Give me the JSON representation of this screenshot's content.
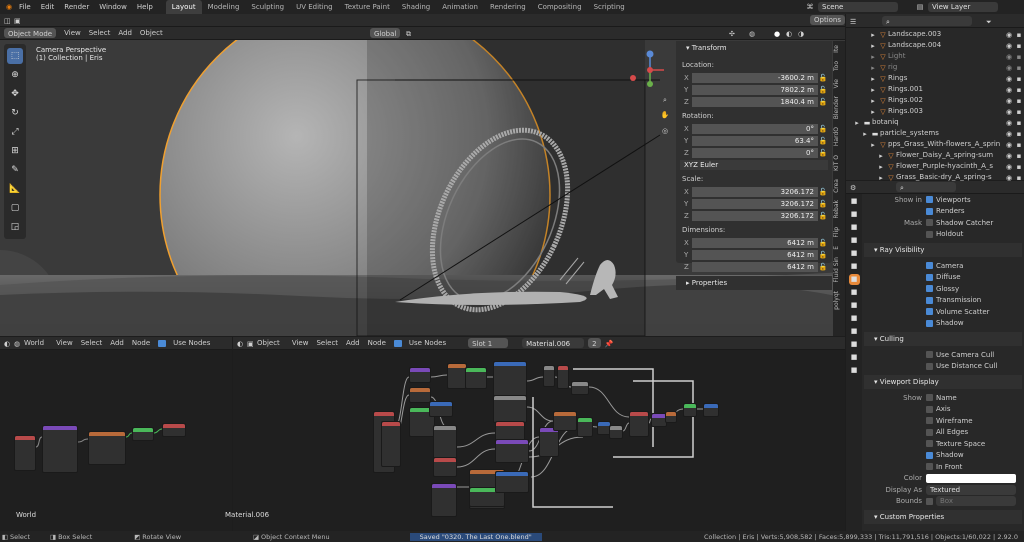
{
  "menu": [
    "File",
    "Edit",
    "Render",
    "Window",
    "Help"
  ],
  "workspaces": [
    {
      "label": "Layout",
      "active": true
    },
    {
      "label": "Modeling"
    },
    {
      "label": "Sculpting"
    },
    {
      "label": "UV Editing"
    },
    {
      "label": "Texture Paint"
    },
    {
      "label": "Shading"
    },
    {
      "label": "Animation"
    },
    {
      "label": "Rendering"
    },
    {
      "label": "Compositing"
    },
    {
      "label": "Scripting"
    }
  ],
  "scene": {
    "label": "Scene",
    "view_layer": "View Layer"
  },
  "viewport": {
    "mode": "Object Mode",
    "menus": [
      "View",
      "Select",
      "Add",
      "Object"
    ],
    "orientation": "Global",
    "options": "Options",
    "info_line1": "Camera Perspective",
    "info_line2": "(1) Collection | Eris"
  },
  "transform": {
    "title": "Transform",
    "location_label": "Location:",
    "location": [
      {
        "axis": "X",
        "value": "-3600.2 m"
      },
      {
        "axis": "Y",
        "value": "7802.2 m"
      },
      {
        "axis": "Z",
        "value": "1840.4 m"
      }
    ],
    "rotation_label": "Rotation:",
    "rotation": [
      {
        "axis": "X",
        "value": "0°"
      },
      {
        "axis": "Y",
        "value": "63.4°"
      },
      {
        "axis": "Z",
        "value": "0°"
      }
    ],
    "rotation_mode": "XYZ Euler",
    "scale_label": "Scale:",
    "scale": [
      {
        "axis": "X",
        "value": "3206.172"
      },
      {
        "axis": "Y",
        "value": "3206.172"
      },
      {
        "axis": "Z",
        "value": "3206.172"
      }
    ],
    "dimensions_label": "Dimensions:",
    "dimensions": [
      {
        "axis": "X",
        "value": "6412 m"
      },
      {
        "axis": "Y",
        "value": "6412 m"
      },
      {
        "axis": "Z",
        "value": "6412 m"
      }
    ],
    "properties": "Properties"
  },
  "npanel_tabs": [
    "Ite",
    "Too",
    "Vie",
    "Blender",
    "HardO",
    "KIT O",
    "Crea",
    "Rebak",
    "Flip",
    "E",
    "Fluid Sin",
    "polyqt"
  ],
  "outliner": [
    {
      "name": "Landscape.003",
      "indent": 2
    },
    {
      "name": "Landscape.004",
      "indent": 2
    },
    {
      "name": "Light",
      "indent": 2,
      "dim": true
    },
    {
      "name": "rig",
      "indent": 2,
      "dim": true
    },
    {
      "name": "Rings",
      "indent": 2
    },
    {
      "name": "Rings.001",
      "indent": 2
    },
    {
      "name": "Rings.002",
      "indent": 2
    },
    {
      "name": "Rings.003",
      "indent": 2
    },
    {
      "name": "botaniq",
      "indent": 0
    },
    {
      "name": "particle_systems",
      "indent": 1
    },
    {
      "name": "pps_Grass_With-flowers_A_sprin",
      "indent": 2
    },
    {
      "name": "Flower_Daisy_A_spring-sum",
      "indent": 3
    },
    {
      "name": "Flower_Purple-hyacinth_A_s",
      "indent": 3
    },
    {
      "name": "Grass_Basic-dry_A_spring-s",
      "indent": 3
    }
  ],
  "properties": {
    "show_in_label": "Show in",
    "viewports": "Viewports",
    "renders": "Renders",
    "mask_label": "Mask",
    "shadow_catcher": "Shadow Catcher",
    "holdout": "Holdout",
    "ray_visibility": "Ray Visibility",
    "ray_items": [
      "Camera",
      "Diffuse",
      "Glossy",
      "Transmission",
      "Volume Scatter",
      "Shadow"
    ],
    "culling": "Culling",
    "culling_items": [
      "Use Camera Cull",
      "Use Distance Cull"
    ],
    "viewport_display": "Viewport Display",
    "show_label": "Show",
    "show_items": [
      {
        "label": "Name",
        "on": false
      },
      {
        "label": "Axis",
        "on": false
      },
      {
        "label": "Wireframe",
        "on": false
      },
      {
        "label": "All Edges",
        "on": false
      },
      {
        "label": "Texture Space",
        "on": false
      },
      {
        "label": "Shadow",
        "on": true
      },
      {
        "label": "In Front",
        "on": false
      }
    ],
    "color_label": "Color",
    "display_as_label": "Display As",
    "display_as": "Textured",
    "bounds_label": "Bounds",
    "bounds_value": "Box",
    "custom_properties": "Custom Properties"
  },
  "node_left": {
    "world": "World",
    "menus": [
      "View",
      "Select",
      "Add",
      "Node"
    ],
    "use_nodes": "Use Nodes",
    "footer": "World"
  },
  "node_right": {
    "type": "Object",
    "menus": [
      "View",
      "Select",
      "Add",
      "Node"
    ],
    "use_nodes": "Use Nodes",
    "slot": "Slot 1",
    "material": "Material.006",
    "users": "2",
    "footer": "Material.006"
  },
  "status": {
    "select": "Select",
    "box_select": "Box Select",
    "rotate": "Rotate View",
    "context": "Object Context Menu",
    "saved": "Saved \"0320. The Last One.blend\"",
    "stats": "Collection | Eris | Verts:5,908,582 | Faces:5,899,333 | Tris:11,791,516 | Objects:1/60,022 | 2.92.0"
  },
  "colors": {
    "accent": "#4a8ad6",
    "selection": "#f0a030",
    "bg": "#1d1d1d",
    "panel": "#2b2b2b"
  }
}
